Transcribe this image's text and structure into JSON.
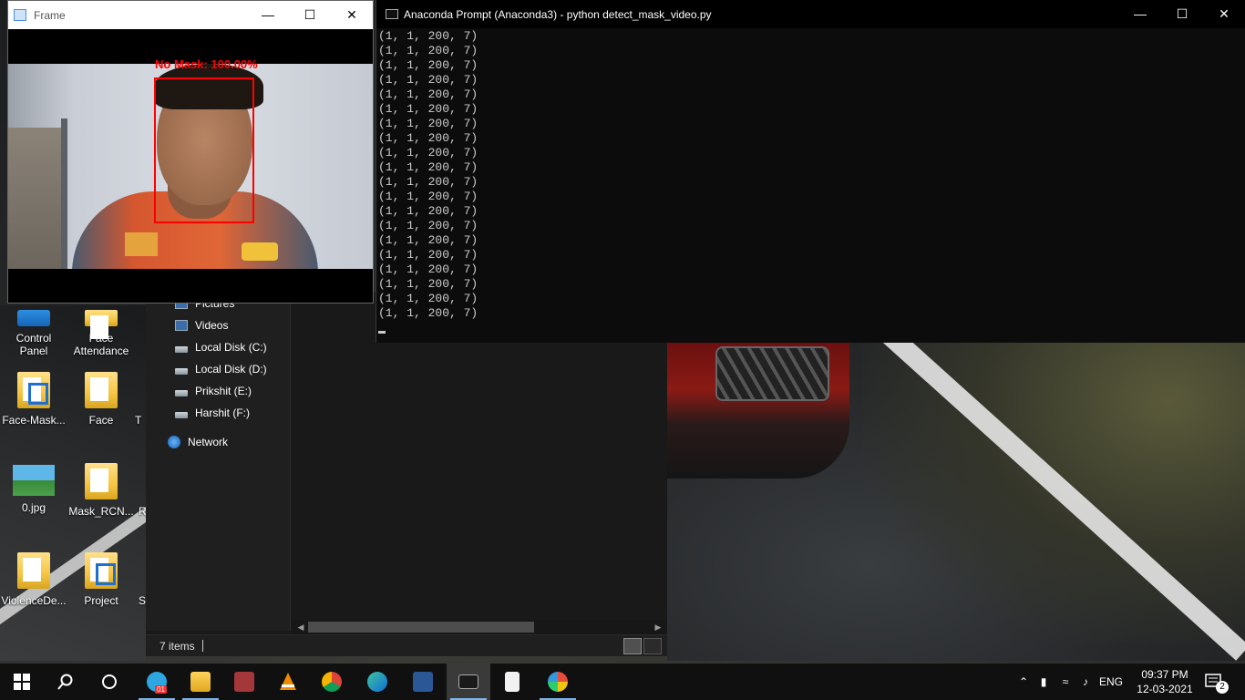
{
  "desktop": {
    "icons": [
      {
        "label": "Control\nPanel",
        "icon": "control-panel-icon"
      },
      {
        "label": "Face\nAttendance",
        "icon": "folder-icon"
      },
      {
        "label": "Face-Mask...",
        "icon": "folder-icon"
      },
      {
        "label": "Face",
        "icon": "folder-icon"
      },
      {
        "label": "T",
        "icon": "folder-icon"
      },
      {
        "label": "0.jpg",
        "icon": "image-file-icon"
      },
      {
        "label": "Mask_RCN...",
        "icon": "folder-icon"
      },
      {
        "label": "R",
        "icon": "folder-icon"
      },
      {
        "label": "ViolenceDe...",
        "icon": "folder-icon"
      },
      {
        "label": "Project",
        "icon": "folder-icon"
      },
      {
        "label": "Su",
        "icon": "folder-icon"
      }
    ]
  },
  "explorer": {
    "nav_items": [
      {
        "label": "Pictures",
        "icon": "pictures-icon"
      },
      {
        "label": "Videos",
        "icon": "videos-icon"
      },
      {
        "label": "Local Disk (C:)",
        "icon": "drive-icon"
      },
      {
        "label": "Local Disk (D:)",
        "icon": "drive-icon"
      },
      {
        "label": "Prikshit (E:)",
        "icon": "drive-icon"
      },
      {
        "label": "Harshit (F:)",
        "icon": "drive-icon"
      },
      {
        "label": "Network",
        "icon": "network-icon"
      }
    ],
    "status": "7 items"
  },
  "frame_window": {
    "title": "Frame",
    "detection_label": "No Mask: 100.00%",
    "detection_color": "#ff0000"
  },
  "prompt_window": {
    "title": "Anaconda Prompt (Anaconda3) - python  detect_mask_video.py",
    "line_text": "(1, 1, 200, 7)",
    "line_count": 20
  },
  "taskbar": {
    "apps": [
      "start-icon",
      "search-icon",
      "task-view-icon",
      "telegram-icon",
      "file-explorer-icon",
      "access-icon",
      "vlc-icon",
      "chrome-icon",
      "edge-icon",
      "word-icon",
      "terminal-icon",
      "notepad-icon",
      "paint-icon"
    ],
    "telegram_badge": "01",
    "language": "ENG",
    "time": "09:37 PM",
    "date": "12-03-2021",
    "notification_count": "2"
  }
}
